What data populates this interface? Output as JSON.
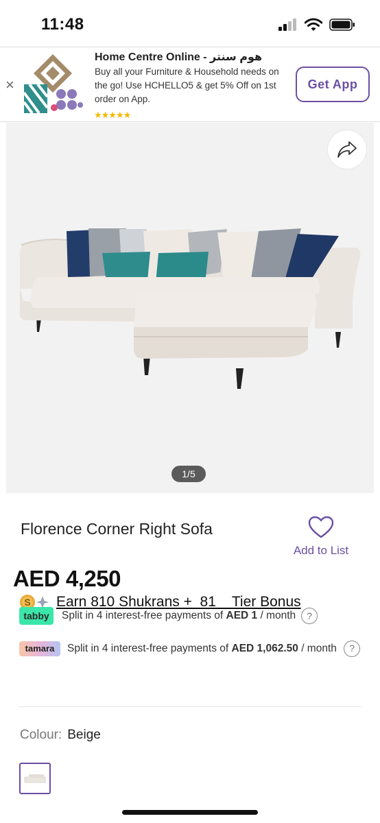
{
  "status": {
    "time": "11:48"
  },
  "banner": {
    "title": "Home Centre Online - هوم سنتر",
    "description": "Buy all your Furniture & Household needs on the go! Use HCHELLO5 & get 5% Off on 1st order on App.",
    "stars": "★★★★★",
    "button": "Get App",
    "close": "×"
  },
  "gallery": {
    "pager": "1/5"
  },
  "product": {
    "title": "Florence Corner Right Sofa",
    "wishlist_label": "Add to List",
    "price": "AED 4,250"
  },
  "rewards": {
    "shukran_text": "Earn 810 Shukrans +  81    Tier Bonus"
  },
  "tabby": {
    "logo": "tabby",
    "text_prefix": "Split in 4 interest-free payments of ",
    "amount": "AED 1",
    "text_suffix": " / month",
    "help": "?"
  },
  "tamara": {
    "logo": "tamara",
    "text_prefix": "Split in 4 interest-free payments of ",
    "amount": "AED 1,062.50",
    "text_suffix": " / month",
    "help": "?"
  },
  "colour": {
    "label": "Colour:",
    "value": "Beige"
  },
  "colors": {
    "accent": "#6b4fa3",
    "tabby": "#3be6a9",
    "stars": "#f5b800"
  }
}
